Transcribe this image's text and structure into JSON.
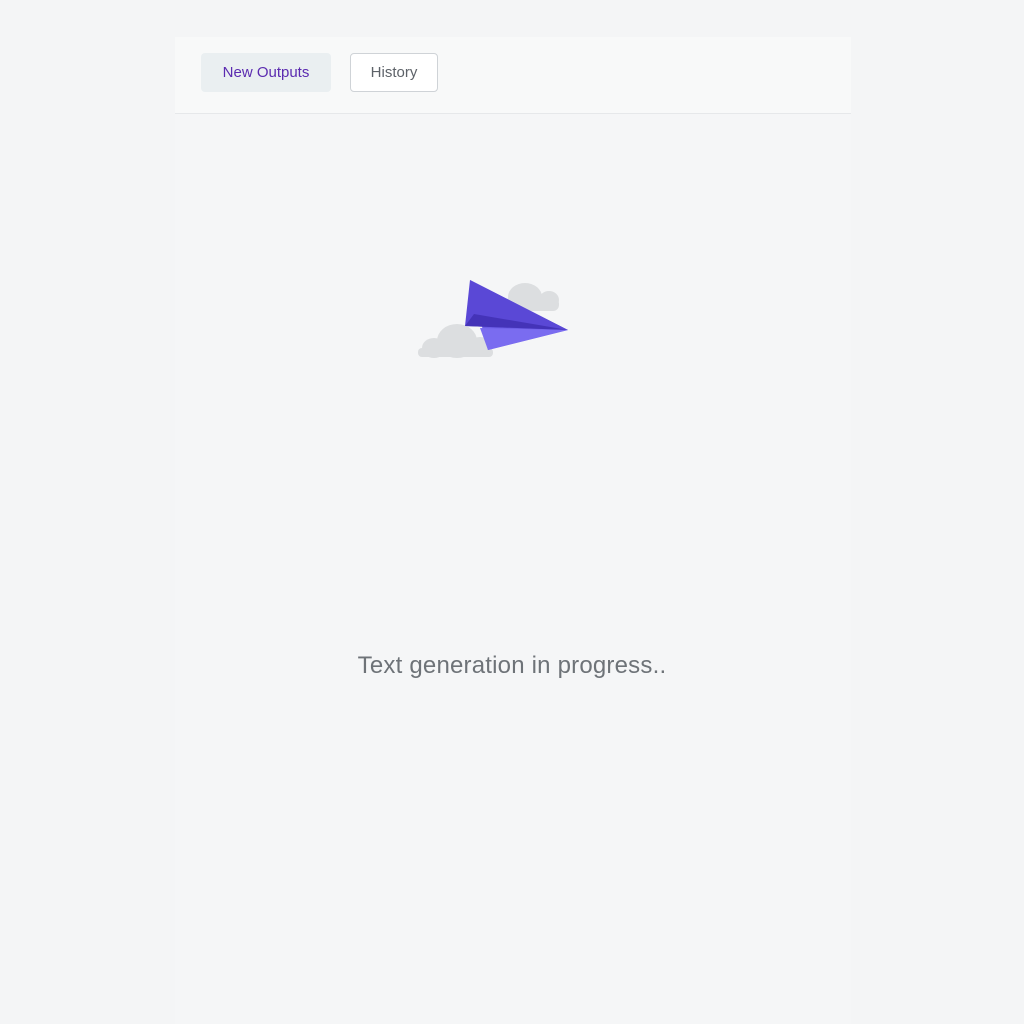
{
  "tabs": {
    "new_outputs_label": "New Outputs",
    "history_label": "History"
  },
  "loading": {
    "status_text": "Text generation in progress.."
  },
  "icons": {
    "illustration": "paper-plane-with-clouds-icon"
  },
  "colors": {
    "accent": "#5b2bb0",
    "plane": "#6a5ae0",
    "cloud": "#dddfe1",
    "background": "#f4f5f6"
  }
}
